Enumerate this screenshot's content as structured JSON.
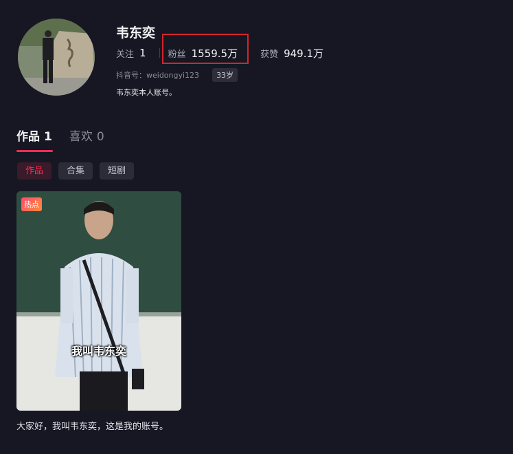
{
  "profile": {
    "name": "韦东奕",
    "following_label": "关注",
    "following_count": "1",
    "followers_label": "粉丝",
    "followers_count": "1559.5万",
    "likes_label": "获赞",
    "likes_count": "949.1万",
    "douyin_id": "抖音号：weidongyi123",
    "age": "33岁",
    "bio": "韦东奕本人账号。"
  },
  "tabs": [
    {
      "label": "作品",
      "count": "1",
      "active": true
    },
    {
      "label": "喜欢",
      "count": "0",
      "active": false
    }
  ],
  "filters": [
    "作品",
    "合集",
    "短剧"
  ],
  "videos": [
    {
      "badge": "热点",
      "subtitle": "我叫韦东奕",
      "caption": "大家好，我叫韦东奕，这是我的账号。"
    }
  ],
  "colors": {
    "background": "#161722",
    "accent": "#fe2c55",
    "highlight_box": "#d3262a"
  }
}
